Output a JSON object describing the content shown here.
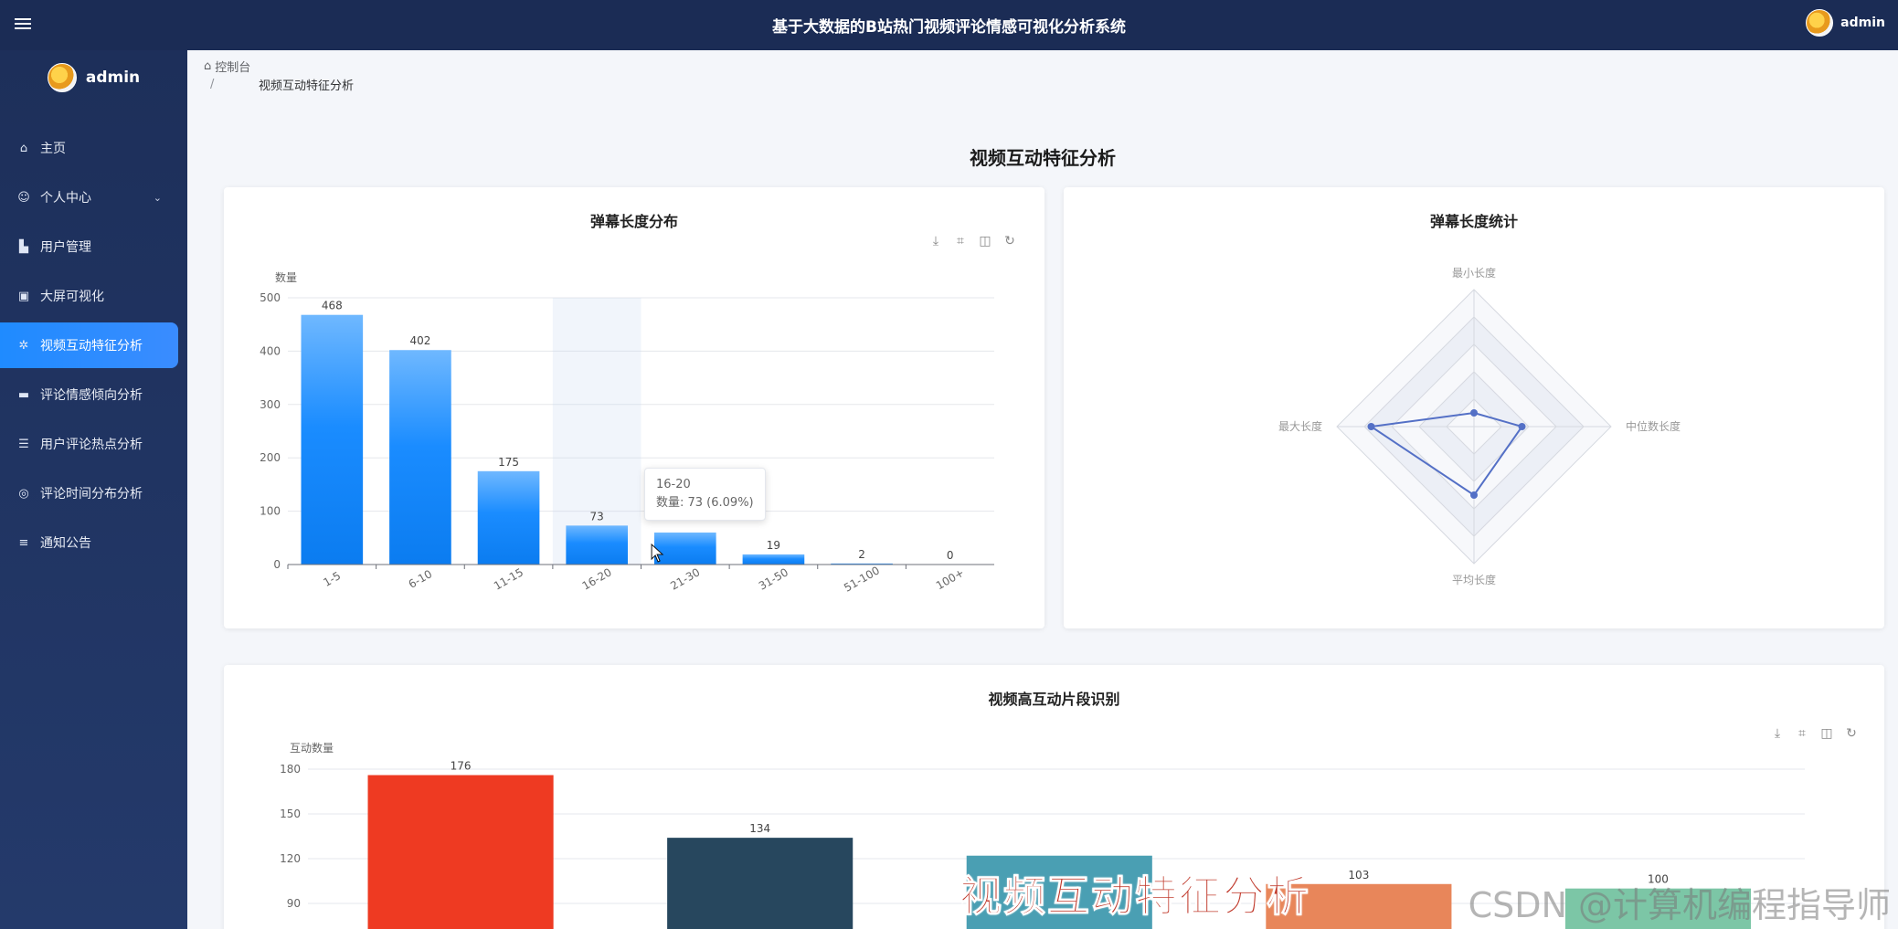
{
  "header": {
    "title": "基于大数据的B站热门视频评论情感可视化分析系统",
    "username": "admin"
  },
  "sidebar": {
    "brand": "admin",
    "items": [
      {
        "label": "主页",
        "icon": "home-icon"
      },
      {
        "label": "个人中心",
        "icon": "user-icon"
      },
      {
        "label": "用户管理",
        "icon": "users-icon"
      },
      {
        "label": "大屏可视化",
        "icon": "clipboard-icon"
      },
      {
        "label": "视频互动特征分析",
        "icon": "network-icon"
      },
      {
        "label": "评论情感倾向分析",
        "icon": "monitor-icon"
      },
      {
        "label": "用户评论热点分析",
        "icon": "sliders-icon"
      },
      {
        "label": "评论时间分布分析",
        "icon": "circle-icon"
      },
      {
        "label": "通知公告",
        "icon": "list-icon"
      }
    ]
  },
  "breadcrumb": {
    "home": "控制台",
    "separator": "/",
    "current": "视频互动特征分析"
  },
  "page_title": "视频互动特征分析",
  "overlay_title": "视频互动特征分析",
  "watermark": "CSDN @计算机编程指导师",
  "tooltip": {
    "title": "16-20",
    "line": "数量: 73 (6.09%)"
  },
  "chart_data": [
    {
      "type": "bar",
      "title": "弹幕长度分布",
      "ylabel": "数量",
      "categories": [
        "1-5",
        "6-10",
        "11-15",
        "16-20",
        "21-30",
        "31-50",
        "51-100",
        "100+"
      ],
      "values": [
        468,
        402,
        175,
        73,
        60,
        19,
        2,
        0
      ],
      "data_labels": [
        "468",
        "402",
        "175",
        "73",
        "",
        "19",
        "2",
        "0"
      ],
      "ylim": [
        0,
        500
      ],
      "yticks": [
        0,
        100,
        200,
        300,
        400,
        500
      ],
      "color": "#1a8cff",
      "highlighted_category": "16-20"
    },
    {
      "type": "radar",
      "title": "弹幕长度统计",
      "indicators": [
        "最小长度",
        "中位数长度",
        "平均长度",
        "最大长度"
      ],
      "values": [
        0.1,
        0.35,
        0.5,
        0.75
      ],
      "color": "#5470c6"
    },
    {
      "type": "bar",
      "title": "视频高互动片段识别",
      "ylabel": "互动数量",
      "yticks": [
        90,
        120,
        150,
        180
      ],
      "ylim": [
        0,
        180
      ],
      "visible_data_labels": [
        "176",
        "134",
        "",
        "103",
        "100"
      ],
      "values": [
        176,
        134,
        122,
        103,
        100
      ],
      "colors": [
        "#ee3a22",
        "#27475e",
        "#4a9fb3",
        "#e8865a",
        "#7cc6a6"
      ]
    }
  ]
}
